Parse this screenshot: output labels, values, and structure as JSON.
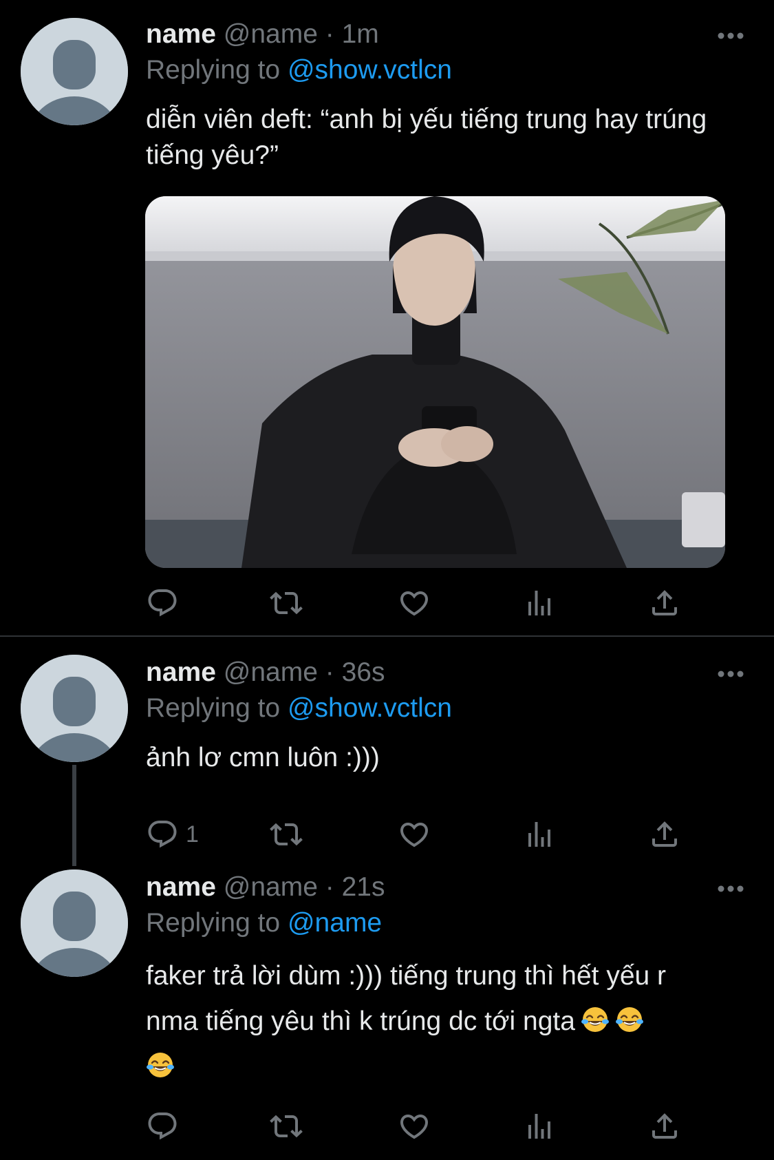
{
  "colors": {
    "background": "#000000",
    "text_primary": "#e7e9ea",
    "text_secondary": "#71767b",
    "accent": "#1d9bf0",
    "avatar_bg": "#ccd6dd",
    "avatar_fg": "#657786",
    "divider": "#2f3336"
  },
  "tweets": [
    {
      "name": "name",
      "handle": "@name",
      "separator": "·",
      "time": "1m",
      "replying_label": "Replying to",
      "replying_to": "@show.vctlcn",
      "text": "diễn viên deft: “anh bị yếu tiếng trung hay trúng tiếng yêu?”",
      "has_media": true,
      "reply_count": ""
    },
    {
      "name": "name",
      "handle": "@name",
      "separator": "·",
      "time": "36s",
      "replying_label": "Replying to",
      "replying_to": "@show.vctlcn",
      "text": "ảnh lơ cmn luôn :)))",
      "reply_count": "1"
    },
    {
      "name": "name",
      "handle": "@name",
      "separator": "·",
      "time": "21s",
      "replying_label": "Replying to",
      "replying_to": "@name",
      "text_line1": "faker trả lời dùm :))) tiếng trung thì hết yếu r",
      "text_line2": "nma tiếng yêu thì k trúng dc tới ngta",
      "emoji_names": [
        "face-with-tears-of-joy-icon",
        "face-with-tears-of-joy-icon",
        "face-with-tears-of-joy-icon"
      ],
      "reply_count": ""
    }
  ],
  "icons": [
    "more-icon",
    "reply-icon",
    "retweet-icon",
    "like-icon",
    "analytics-icon",
    "share-icon"
  ]
}
